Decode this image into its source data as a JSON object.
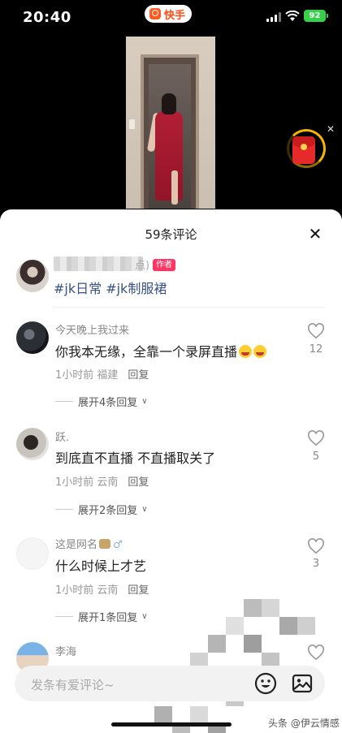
{
  "status_bar": {
    "time": "20:40",
    "app_name": "快手",
    "battery": "92"
  },
  "video": {
    "icons": [
      "red-packet-icon",
      "close-icon"
    ]
  },
  "comments_panel": {
    "title": "59条评论",
    "close_icon": "close-icon",
    "author_post": {
      "name_suffix": "点)",
      "badge": "作者",
      "hashtags": "#jk日常 #jk制服裙"
    },
    "comments": [
      {
        "username": "今天晚上我过来",
        "text": "你我本无缘，全靠一个录屏直播",
        "emojis": [
          "laugh-cry-emoji",
          "laugh-cry-emoji"
        ],
        "time_location": "1小时前 福建",
        "reply_label": "回复",
        "likes": "12",
        "expand_label": "展开4条回复"
      },
      {
        "username": "跃.",
        "text": "到底直不直播 不直播取关了",
        "time_location": "1小时前 云南",
        "reply_label": "回复",
        "likes": "5",
        "expand_label": "展开2条回复"
      },
      {
        "username": "这是网名",
        "gender": "♂",
        "text": "什么时候上才艺",
        "time_location": "1小时前 云南",
        "reply_label": "回复",
        "likes": "3",
        "expand_label": "展开1条回复"
      },
      {
        "username": "李海"
      }
    ],
    "input": {
      "placeholder": "发条有爱评论~"
    }
  },
  "watermark": "头条 @伊云情感",
  "colors": {
    "accent_badge": "#fe3666",
    "hashtag": "#375187",
    "battery": "#36d04a",
    "app_logo": "#ff5a1f"
  }
}
